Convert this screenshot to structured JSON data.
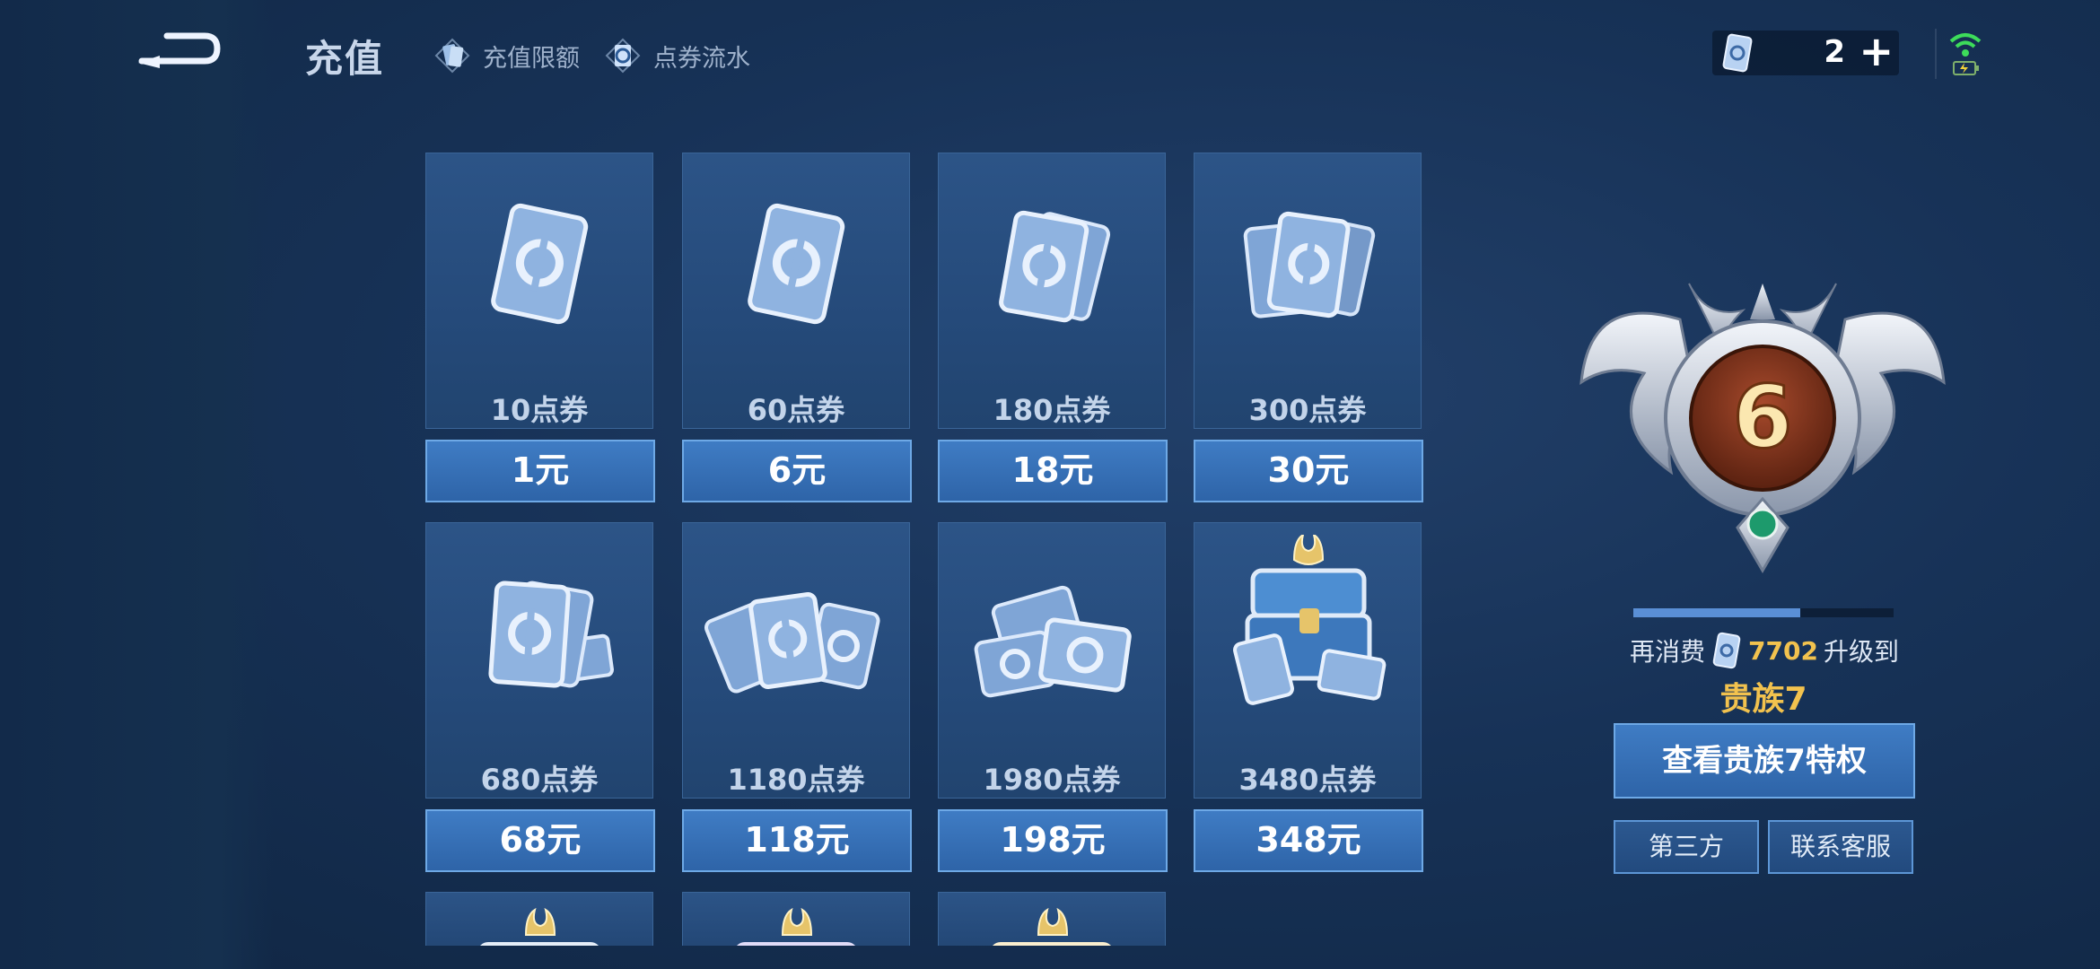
{
  "header": {
    "title": "充值",
    "links": [
      {
        "label": "充值限额",
        "icon": "card-icon"
      },
      {
        "label": "点券流水",
        "icon": "voucher-icon"
      }
    ],
    "currency": {
      "count": "2",
      "plus": "+"
    }
  },
  "cards": [
    {
      "label": "10点券",
      "price": "1元",
      "icon": "single-voucher"
    },
    {
      "label": "60点券",
      "price": "6元",
      "icon": "single-voucher"
    },
    {
      "label": "180点券",
      "price": "18元",
      "icon": "double-voucher"
    },
    {
      "label": "300点券",
      "price": "30元",
      "icon": "triple-voucher"
    },
    {
      "label": "680点券",
      "price": "68元",
      "icon": "voucher-stack"
    },
    {
      "label": "1180点券",
      "price": "118元",
      "icon": "voucher-pile"
    },
    {
      "label": "1980点券",
      "price": "198元",
      "icon": "voucher-heap"
    },
    {
      "label": "3480点券",
      "price": "348元",
      "icon": "treasure-chest"
    }
  ],
  "partial_cards": [
    {
      "icon": "silver-chest"
    },
    {
      "icon": "purple-chest"
    },
    {
      "icon": "gold-chest"
    }
  ],
  "noble": {
    "level": "6",
    "progress": 0.64,
    "upgrade_prefix": "再消费",
    "upgrade_amount": "7702",
    "upgrade_suffix": "升级到",
    "target": "贵族7",
    "privilege_button": "查看贵族7特权",
    "third_party_button": "第三方",
    "service_button": "联系客服"
  },
  "colors": {
    "accent_gold": "#f2c24e",
    "button_blue": "#3f7cc4",
    "background": "#173257"
  }
}
